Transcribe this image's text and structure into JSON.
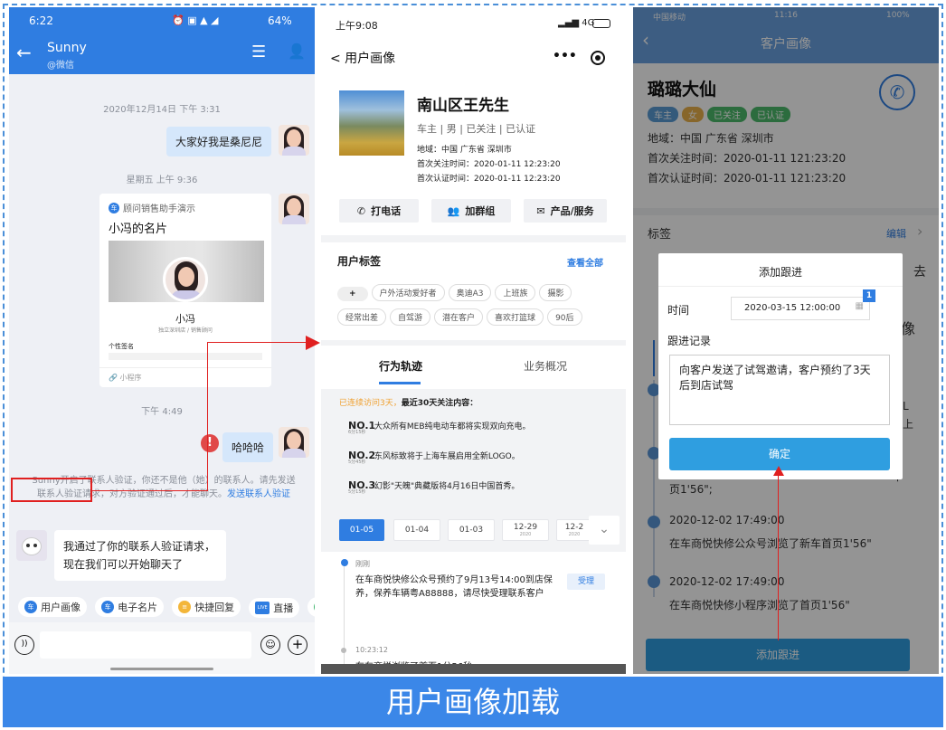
{
  "banner": "用户画像加载",
  "phone1": {
    "status_time": "6:22",
    "status_right": "64%",
    "contact_name": "Sunny",
    "contact_sub": "@微信",
    "ts1": "2020年12月14日 下午 3:31",
    "msg1": "大家好我是桑尼尼",
    "ts2": "星期五 上午 9:36",
    "card_source": "顾问销售助手演示",
    "card_title": "小冯的名片",
    "card_name": "小冯",
    "card_sub": "独立深圳店 / 销售顾问",
    "card_sign": "个性签名",
    "card_footer": "小程序",
    "ts3": "下午 4:49",
    "msg2": "哈哈哈",
    "sys_notice": "Sunny开启了联系人验证，你还不是他（她）的联系人。请先发送联系人验证请求，对方验证通过后，才能聊天。",
    "sys_link": "发送联系人验证",
    "msg3": "我通过了你的联系人验证请求，现在我们可以开始聊天了",
    "toolbar": [
      {
        "label": "用户画像",
        "icon": "车"
      },
      {
        "label": "电子名片",
        "icon": "车"
      },
      {
        "label": "快捷回复",
        "icon": "≡"
      },
      {
        "label": "直播",
        "icon": "LIVE"
      },
      {
        "label": "司",
        "icon": "人"
      }
    ]
  },
  "phone2": {
    "status_time": "上午9:08",
    "status_right": "4G",
    "back_title": "< 用户画像",
    "name": "南山区王先生",
    "tags_inline": "车主  |  男  |  已关注  |  已认证",
    "region": "地域：中国  广东省  深圳市",
    "first_follow": "首次关注时间：2020-01-11 12:23:20",
    "first_auth": "首次认证时间：2020-01-11 12:23:20",
    "btn_call": "打电话",
    "btn_group": "加群组",
    "btn_product": "产品/服务",
    "tags_title": "用户标签",
    "view_all": "查看全部",
    "tags": [
      "+",
      "户外活动爱好者",
      "奥迪A3",
      "上班族",
      "摄影",
      "经常出差",
      "自驾游",
      "潜在客户",
      "喜欢打篮球",
      "90后"
    ],
    "tab_active": "行为轨迹",
    "tab_other": "业务概况",
    "visits_warn": "已连续访问3天，",
    "visits_text": "最近30天关注内容：",
    "news": [
      {
        "no": "NO.1",
        "dur": "6分15秒",
        "text": "大众所有MEB纯电动车都将实现双向充电。"
      },
      {
        "no": "NO.2",
        "dur": "5分45秒",
        "text": "东风标致将于上海车展启用全新LOGO。"
      },
      {
        "no": "NO.3",
        "dur": "5分15秒",
        "text": "幻影\"天魄\"典藏版将4月16日中国首秀。"
      }
    ],
    "dates": [
      "01-05",
      "01-04",
      "01-03",
      "12-29",
      "12-2"
    ],
    "date_years": [
      "",
      "",
      "",
      "2020",
      "2020"
    ],
    "event1_time": "刚刚",
    "event1_text": "在车商悦快修公众号预约了9月13号14:00到店保养，保养车辆粤A88888，请尽快受理联系客户",
    "event1_btn": "受理",
    "event2_time": "10:23:12",
    "event2_text": "在车商悦浏览了首页1分56秒"
  },
  "phone3": {
    "status_carrier": "中国移动",
    "status_time": "11:16",
    "status_battery": "100%",
    "title": "客户画像",
    "name": "璐璐大仙",
    "tags": [
      {
        "label": "车主",
        "color": "#5b9bd5"
      },
      {
        "label": "女",
        "color": "#e8b04a"
      },
      {
        "label": "已关注",
        "color": "#4cba6b"
      },
      {
        "label": "已认证",
        "color": "#4cba6b"
      }
    ],
    "region": "地域：中国 广东省 深圳市",
    "first_follow": "首次关注时间：2020-01-11 121:23:20",
    "first_auth": "首次认证时间：2020-01-11 121:23:20",
    "tags_title": "标签",
    "edit": "编辑",
    "dialog_title": "添加跟进",
    "time_label": "时间",
    "time_value": "2020-03-15 12:00:00",
    "badge": "1",
    "record_label": "跟进记录",
    "record_text": "向客户发送了试驾邀请，客户预约了3天后到店试驾",
    "confirm": "确定",
    "partial_text": "页1'56\";",
    "tl1_time": "2020-12-02 17:49:00",
    "tl1_text": "在车商悦快修公众号浏览了新车首页1'56\"",
    "tl2_time": "2020-12-02 17:49:00",
    "tl2_text": "在车商悦快修小程序浏览了首页1'56\"",
    "add_btn": "添加跟进",
    "edge_chars": [
      "去",
      "像",
      "L",
      "上",
      "车"
    ]
  }
}
